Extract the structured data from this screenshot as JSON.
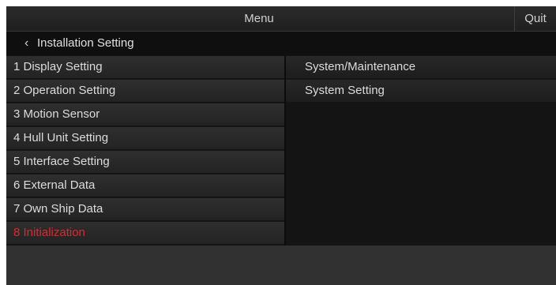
{
  "topbar": {
    "title": "Menu",
    "quit_label": "Quit"
  },
  "header": {
    "back_icon": "chevron-left-icon",
    "title": "Installation Setting"
  },
  "left_menu": [
    {
      "label": "1 Display Setting",
      "active": false
    },
    {
      "label": "2 Operation Setting",
      "active": false
    },
    {
      "label": "3 Motion Sensor",
      "active": false
    },
    {
      "label": "4 Hull Unit Setting",
      "active": false
    },
    {
      "label": "5 Interface Setting",
      "active": false
    },
    {
      "label": "6 External Data",
      "active": false
    },
    {
      "label": "7 Own Ship Data",
      "active": false
    },
    {
      "label": "8 Initialization",
      "active": true
    }
  ],
  "right_menu": [
    {
      "label": "System/Maintenance"
    },
    {
      "label": "System Setting"
    }
  ],
  "colors": {
    "active_text": "#e3262b",
    "panel_background": "#141414",
    "bottom_bar": "#313131"
  }
}
